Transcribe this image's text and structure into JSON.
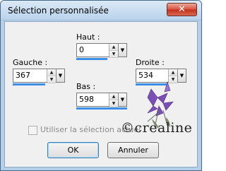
{
  "window": {
    "title": "Sélection personnalisée",
    "close_glyph": "✕"
  },
  "fields": {
    "haut": {
      "label": "Haut :",
      "value": "0"
    },
    "gauche": {
      "label": "Gauche :",
      "value": "367"
    },
    "droite": {
      "label": "Droite :",
      "value": "534"
    },
    "bas": {
      "label": "Bas :",
      "value": "598"
    }
  },
  "checkbox": {
    "label": "Utiliser la  sélection actuel",
    "checked": false
  },
  "buttons": {
    "ok": "OK",
    "cancel": "Annuler"
  },
  "watermark": {
    "text": "©crealine",
    "icon": "purple-flowers-icon"
  },
  "colors": {
    "accent_bar": "#3d8ee6",
    "flower": "#7b4fb6"
  }
}
